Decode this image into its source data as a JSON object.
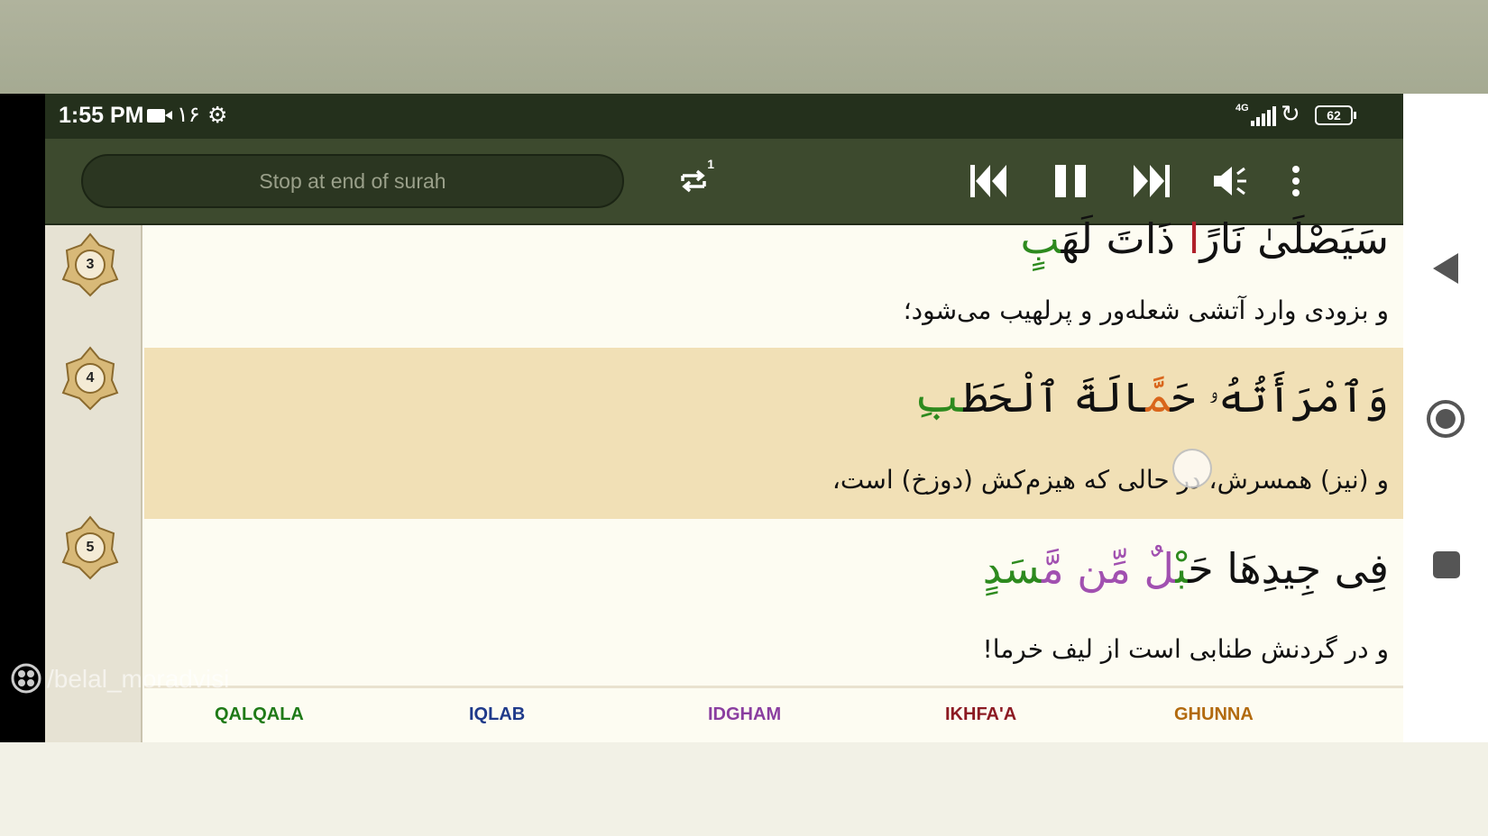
{
  "status_bar": {
    "time": "1:55 PM",
    "notification_count": "۱۶",
    "network": "4G",
    "battery": "62"
  },
  "player": {
    "stop_mode": "Stop at end of surah",
    "repeat_count": "1"
  },
  "verses": [
    {
      "number": "3",
      "arabic": [
        {
          "t": "سَيَصْلَىٰ ",
          "c": "n"
        },
        {
          "t": "نَارً",
          "c": "n"
        },
        {
          "t": "ا ",
          "c": "r"
        },
        {
          "t": "ذَاتَ لَهَ",
          "c": "n"
        },
        {
          "t": "بٍ",
          "c": "g"
        }
      ],
      "translation": "و بزودی وارد آتشی شعله‌ور و پرلهیب می‌شود؛"
    },
    {
      "number": "4",
      "arabic": [
        {
          "t": "وَٱمْرَأَتُهُۥ حَ",
          "c": "n"
        },
        {
          "t": "مَّ",
          "c": "o"
        },
        {
          "t": "الَةَ ٱلْحَطَ",
          "c": "n"
        },
        {
          "t": "بِ",
          "c": "g"
        }
      ],
      "translation": "و (نیز) همسرش، در حالی که هیزم‌کش (دوزخ) است،"
    },
    {
      "number": "5",
      "arabic": [
        {
          "t": "فِى جِيدِهَا حَ",
          "c": "n"
        },
        {
          "t": "بْ",
          "c": "g"
        },
        {
          "t": "لٌ مِّن مَّ",
          "c": "p"
        },
        {
          "t": "سَدٍ",
          "c": "g"
        }
      ],
      "translation": "و در گردنش طنابی است از لیف خرما!"
    }
  ],
  "legend": [
    {
      "label": "QALQALA",
      "color": "#1f7a17"
    },
    {
      "label": "IQLAB",
      "color": "#1f3a8a"
    },
    {
      "label": "IDGHAM",
      "color": "#8a3ea0"
    },
    {
      "label": "IKHFA'A",
      "color": "#8c1a22"
    },
    {
      "label": "GHUNNA",
      "color": "#b26a0e"
    }
  ],
  "watermark": "/belal_moradvisi",
  "colors": {
    "status_bar": "#24301c",
    "toolbar": "#3d4a2e",
    "highlight": "#f1e0b6",
    "page": "#fdfcf2"
  }
}
